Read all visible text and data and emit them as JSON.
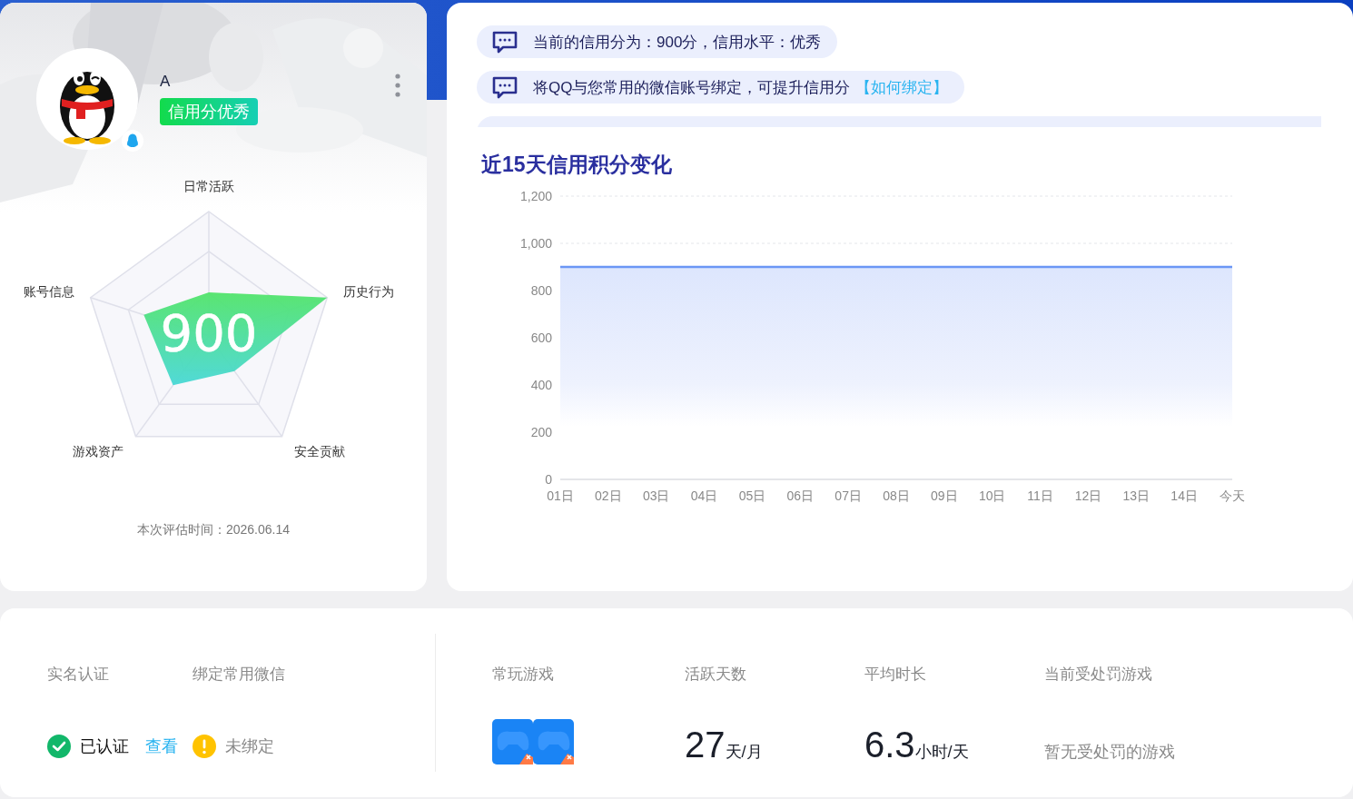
{
  "profile": {
    "name": "A",
    "badge": "信用分优秀",
    "score": "900",
    "radar_labels": [
      "日常活跃",
      "历史行为",
      "安全贡献",
      "游戏资产",
      "账号信息"
    ],
    "eval_time": "本次评估时间：2026.06.14"
  },
  "notices": [
    {
      "kind": "text",
      "text": "当前的信用分为：900分，信用水平：优秀"
    },
    {
      "kind": "text",
      "text": "将QQ与您常用的微信账号绑定，可提升信用分",
      "link": "【如何绑定】"
    },
    {
      "kind": "cut"
    }
  ],
  "trend": {
    "title": "近15天信用积分变化",
    "chart_data": {
      "type": "area",
      "categories": [
        "01日",
        "02日",
        "03日",
        "04日",
        "05日",
        "06日",
        "07日",
        "08日",
        "09日",
        "10日",
        "11日",
        "12日",
        "13日",
        "14日",
        "今天"
      ],
      "series": [
        {
          "color": "#6b96f5",
          "values": [
            900,
            900,
            900,
            900,
            900,
            900,
            900,
            900,
            900,
            900,
            900,
            900,
            900,
            900,
            900
          ]
        }
      ],
      "ylim": [
        0,
        1200
      ],
      "yticks": [
        0,
        200,
        400,
        600,
        800,
        {
          "value": 1000,
          "label": "1,000"
        },
        {
          "value": 1200,
          "label": "1,200"
        }
      ]
    }
  },
  "account": [
    {
      "label": "实名认证",
      "status": "已认证",
      "verified": true,
      "link": "查看"
    },
    {
      "label": "绑定常用微信",
      "status": "未绑定",
      "verified": false
    }
  ],
  "games": {
    "label": "常玩游戏",
    "items": [
      {
        "kind": "game"
      },
      {
        "kind": "game"
      }
    ]
  },
  "metrics": [
    {
      "label": "活跃天数",
      "value": "27",
      "unit": "天/月"
    },
    {
      "label": "平均时长",
      "value": "6.3",
      "unit": "小时/天"
    }
  ],
  "punished": {
    "label": "当前受处罚游戏",
    "text": "暂无受处罚的游戏"
  }
}
